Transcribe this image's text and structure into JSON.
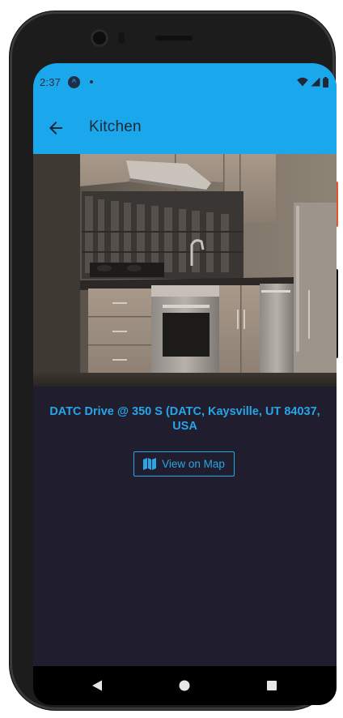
{
  "status_bar": {
    "time": "2:37",
    "app_icon": "expo-icon",
    "notification_dot": true,
    "icons": [
      "wifi-icon",
      "cell-signal-icon",
      "battery-icon"
    ]
  },
  "app_bar": {
    "title": "Kitchen",
    "back_icon": "arrow-left-icon",
    "background_color": "#1ba7ec"
  },
  "photo": {
    "subject": "kitchen-photo"
  },
  "location": {
    "address": "DATC Drive @ 350 S (DATC, Kaysville, UT 84037, USA",
    "accent_color": "#27a5e8"
  },
  "map_button": {
    "label": "View on Map",
    "icon": "map-icon"
  },
  "nav_bar": {
    "items": [
      "back-triangle-icon",
      "home-circle-icon",
      "recents-square-icon"
    ]
  },
  "colors": {
    "screen_background": "#201d2e",
    "primary": "#1ba7ec"
  }
}
